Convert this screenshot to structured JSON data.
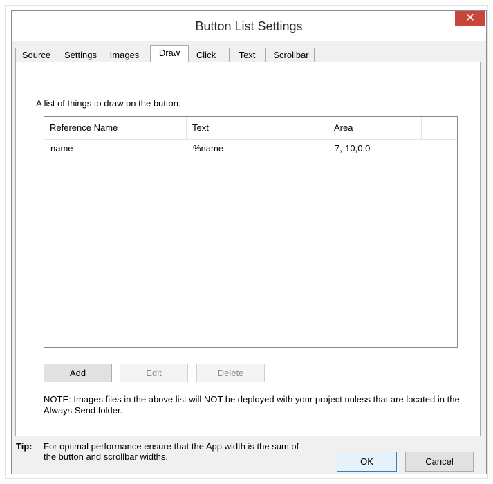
{
  "window": {
    "title": "Button List Settings",
    "close_glyph": "✕"
  },
  "tabs": [
    {
      "label": "Source",
      "active": false
    },
    {
      "label": "Settings",
      "active": false
    },
    {
      "label": "Images",
      "active": false
    },
    {
      "label": "Draw",
      "active": true
    },
    {
      "label": "Click",
      "active": false
    },
    {
      "label": "Text",
      "active": false
    },
    {
      "label": "Scrollbar",
      "active": false
    }
  ],
  "draw_tab": {
    "description": "A list of things to draw on the button.",
    "columns": [
      "Reference Name",
      "Text",
      "Area"
    ],
    "rows": [
      {
        "reference_name": "name",
        "text": "%name",
        "area": "7,-10,0,0"
      }
    ],
    "buttons": {
      "add": "Add",
      "edit": "Edit",
      "delete": "Delete"
    },
    "note": "NOTE: Images files in the above list will NOT be deployed with your project unless that are located in the Always Send folder."
  },
  "footer": {
    "tip_label": "Tip:",
    "tip_text": "For optimal performance ensure that the App width is the sum of the button and scrollbar widths.",
    "ok_label": "OK",
    "cancel_label": "Cancel"
  },
  "colors": {
    "close_button": "#c7453b",
    "window_bg": "#f0f0f0",
    "panel_bg": "#ffffff"
  }
}
